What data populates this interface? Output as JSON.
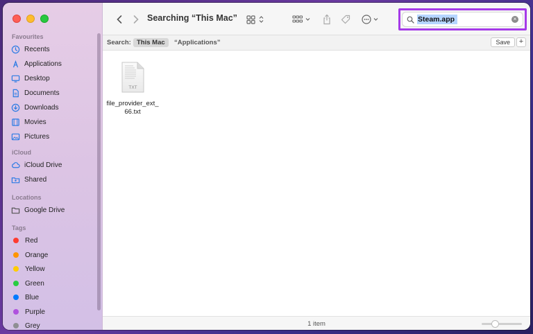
{
  "window": {
    "title": "Searching “This Mac”"
  },
  "sidebar": {
    "favourites_title": "Favourites",
    "favourites": [
      {
        "label": "Recents",
        "icon": "clock-icon"
      },
      {
        "label": "Applications",
        "icon": "applications-icon"
      },
      {
        "label": "Desktop",
        "icon": "desktop-icon"
      },
      {
        "label": "Documents",
        "icon": "document-icon"
      },
      {
        "label": "Downloads",
        "icon": "download-icon"
      },
      {
        "label": "Movies",
        "icon": "film-icon"
      },
      {
        "label": "Pictures",
        "icon": "photo-icon"
      }
    ],
    "icloud_title": "iCloud",
    "icloud": [
      {
        "label": "iCloud Drive",
        "icon": "cloud-icon"
      },
      {
        "label": "Shared",
        "icon": "shared-folder-icon"
      }
    ],
    "locations_title": "Locations",
    "locations": [
      {
        "label": "Google Drive",
        "icon": "folder-icon"
      }
    ],
    "tags_title": "Tags",
    "tags": [
      {
        "label": "Red",
        "color": "#fe3b30"
      },
      {
        "label": "Orange",
        "color": "#ff9500"
      },
      {
        "label": "Yellow",
        "color": "#ffcc00"
      },
      {
        "label": "Green",
        "color": "#28cd41"
      },
      {
        "label": "Blue",
        "color": "#007aff"
      },
      {
        "label": "Purple",
        "color": "#af52de"
      },
      {
        "label": "Grey",
        "color": "#8e8e93"
      }
    ]
  },
  "search": {
    "value": "Steam.app",
    "highlight_color": "#a53ae8"
  },
  "scope": {
    "label": "Search:",
    "this_mac": "This Mac",
    "applications": "“Applications”",
    "save": "Save",
    "add": "+"
  },
  "files": [
    {
      "name": "file_provider_ext_66.txt",
      "line1": "file_provider_ext_",
      "line2": "66.txt",
      "badge": "TXT"
    }
  ],
  "status": {
    "count": "1 item",
    "zoom": 0.3
  }
}
